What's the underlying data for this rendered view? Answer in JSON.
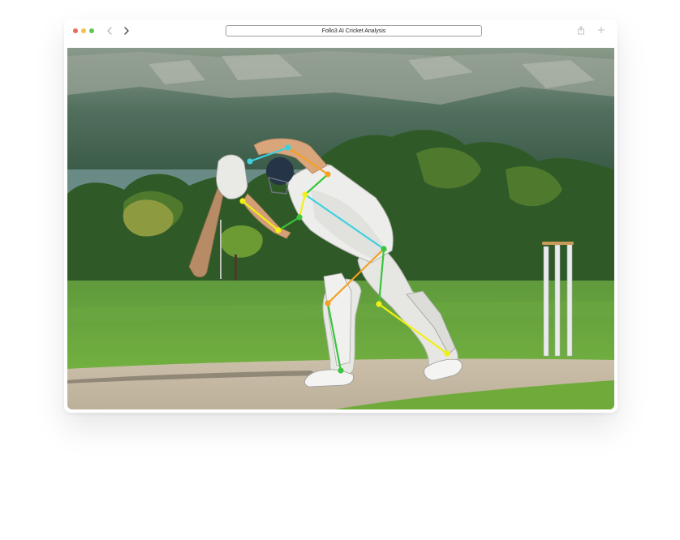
{
  "browser": {
    "address_text": "Follo3 AI Cricket Analysis",
    "icons": {
      "back": "chevron-left-icon",
      "forward": "chevron-right-icon",
      "share": "share-icon",
      "new_tab": "plus-icon"
    },
    "traffic_lights": [
      "#ec6a5e",
      "#f4bf4f",
      "#61c554"
    ]
  },
  "viewer": {
    "image_subject": "cricket-batsman-pose-analysis",
    "skeleton_colors": {
      "yellow": "#f1f014",
      "orange": "#f4a023",
      "green": "#39c53c",
      "cyan": "#3fd0e0"
    }
  }
}
